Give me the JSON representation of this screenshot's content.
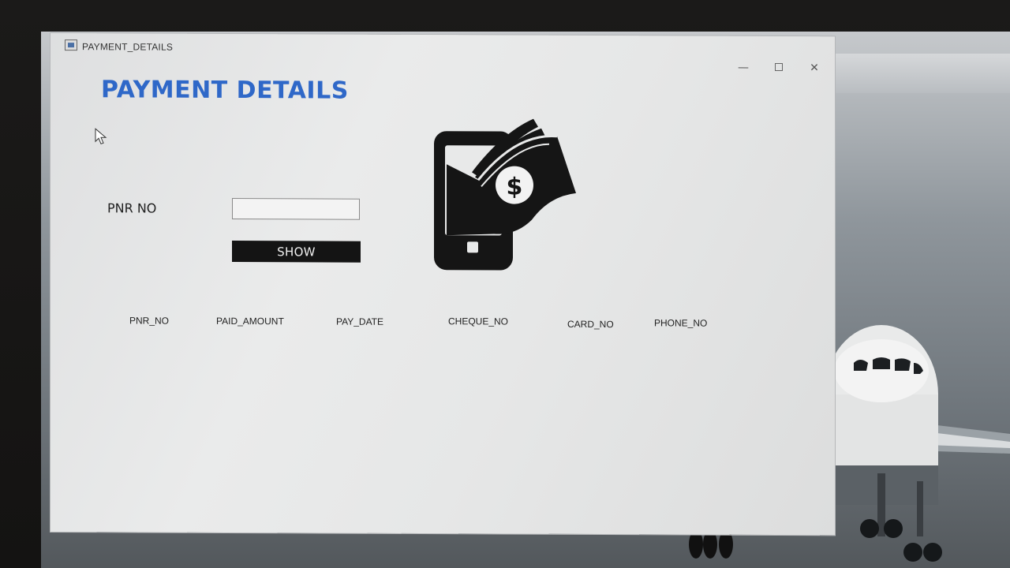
{
  "window": {
    "title": "PAYMENT_DETAILS",
    "minimize": "—",
    "close": "✕"
  },
  "page": {
    "heading": "PAYMENT DETAILS",
    "heading_color": "#2f68c8"
  },
  "form": {
    "pnr_label": "PNR NO",
    "pnr_value": "",
    "show_label": "SHOW"
  },
  "table": {
    "columns": [
      "PNR_NO",
      "PAID_AMOUNT",
      "PAY_DATE",
      "CHEQUE_NO",
      "CARD_NO",
      "PHONE_NO"
    ],
    "rows": []
  },
  "icons": {
    "app": "java-window-icon",
    "illustration": "mobile-payment-icon",
    "cursor": "mouse-pointer-icon"
  }
}
